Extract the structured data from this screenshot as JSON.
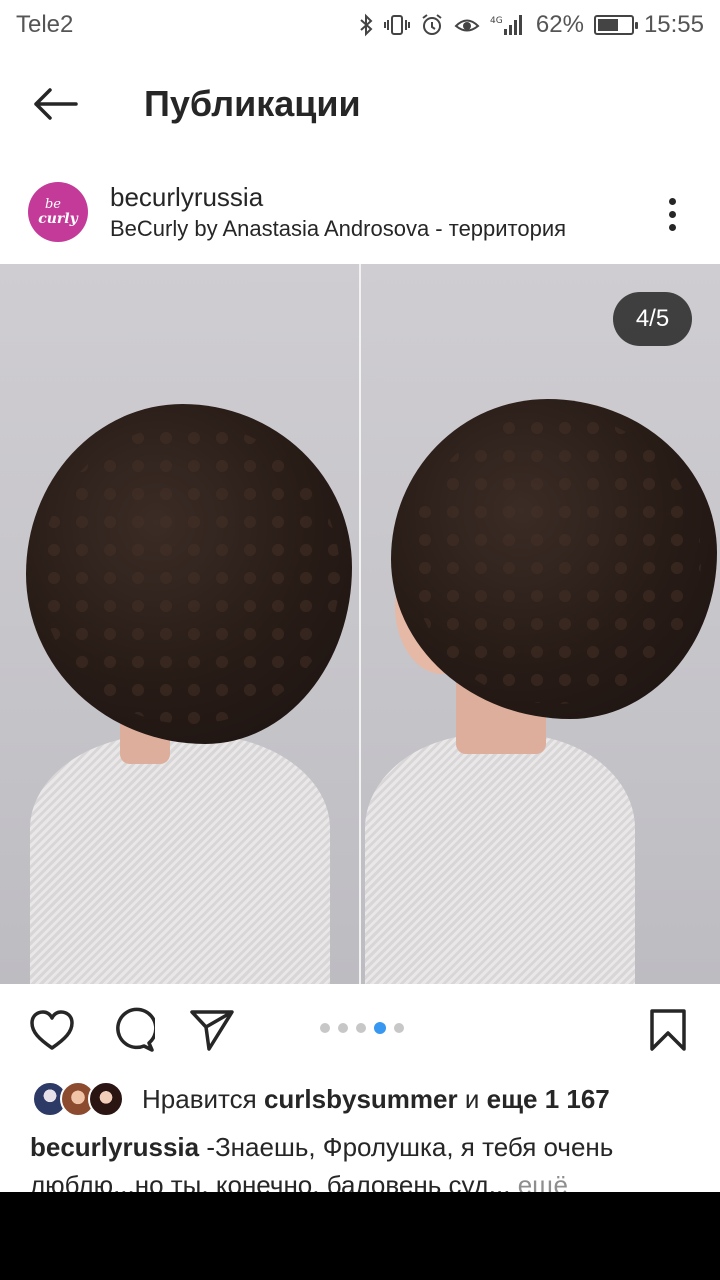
{
  "status_bar": {
    "carrier": "Tele2",
    "icons": [
      "bluetooth-icon",
      "vibrate-icon",
      "alarm-icon",
      "eye-comfort-icon",
      "4g-signal-icon",
      "battery-icon"
    ],
    "battery_percent": "62%",
    "battery_level": 0.62,
    "time": "15:55"
  },
  "header": {
    "title": "Публикации",
    "back_icon": "back-arrow-icon"
  },
  "post": {
    "avatar_text_line1": "be",
    "avatar_text_line2": "curly",
    "avatar_color": "#c43a99",
    "username": "becurlyrussia",
    "location": "BeCurly by Anastasia Androsova - территория",
    "image_counter": "4/5",
    "carousel": {
      "total": 5,
      "active_index": 3
    },
    "actions": [
      "heart-icon",
      "comment-icon",
      "share-icon",
      "bookmark-icon"
    ],
    "likes": {
      "prefix": "Нравится",
      "user": "curlsbysummer",
      "conj": "и",
      "rest": "еще 1 167"
    },
    "caption": {
      "username": "becurlyrussia",
      "text": " -Знаешь, Фролушка, я тебя очень люблю...но ты, конечно, баловень суд...",
      "more": " ещё"
    }
  },
  "colors": {
    "accent": "#3897f0",
    "text": "#262626",
    "muted": "#8e8e8e"
  }
}
